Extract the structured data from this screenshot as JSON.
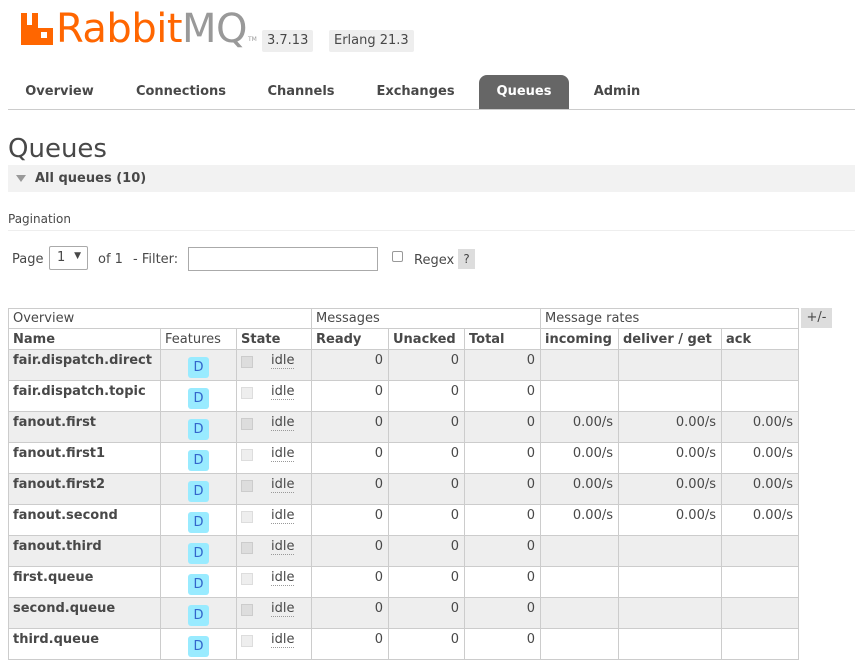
{
  "header": {
    "logo_text_rabbit": "Rabbit",
    "logo_text_mq": "MQ",
    "logo_tm": "TM",
    "version": "3.7.13",
    "erlang": "Erlang 21.3"
  },
  "nav": {
    "tabs": [
      {
        "label": "Overview"
      },
      {
        "label": "Connections"
      },
      {
        "label": "Channels"
      },
      {
        "label": "Exchanges"
      },
      {
        "label": "Queues",
        "active": true
      },
      {
        "label": "Admin"
      }
    ]
  },
  "page": {
    "title": "Queues",
    "section": "All queues (10)"
  },
  "pagination": {
    "title": "Pagination",
    "page_label": "Page",
    "page_value": "1",
    "of_label": "of 1",
    "filter_label": "- Filter:",
    "filter_value": "",
    "regex_label": "Regex",
    "help_label": "?"
  },
  "table": {
    "groups": {
      "overview": "Overview",
      "messages": "Messages",
      "rates": "Message rates"
    },
    "toggle_label": "+/-",
    "columns": {
      "name": "Name",
      "features": "Features",
      "state": "State",
      "ready": "Ready",
      "unacked": "Unacked",
      "total": "Total",
      "incoming": "incoming",
      "deliver_get": "deliver / get",
      "ack": "ack"
    },
    "rows": [
      {
        "name": "fair.dispatch.direct",
        "feature": "D",
        "state": "idle",
        "ready": "0",
        "unacked": "0",
        "total": "0",
        "incoming": "",
        "deliver_get": "",
        "ack": ""
      },
      {
        "name": "fair.dispatch.topic",
        "feature": "D",
        "state": "idle",
        "ready": "0",
        "unacked": "0",
        "total": "0",
        "incoming": "",
        "deliver_get": "",
        "ack": ""
      },
      {
        "name": "fanout.first",
        "feature": "D",
        "state": "idle",
        "ready": "0",
        "unacked": "0",
        "total": "0",
        "incoming": "0.00/s",
        "deliver_get": "0.00/s",
        "ack": "0.00/s"
      },
      {
        "name": "fanout.first1",
        "feature": "D",
        "state": "idle",
        "ready": "0",
        "unacked": "0",
        "total": "0",
        "incoming": "0.00/s",
        "deliver_get": "0.00/s",
        "ack": "0.00/s"
      },
      {
        "name": "fanout.first2",
        "feature": "D",
        "state": "idle",
        "ready": "0",
        "unacked": "0",
        "total": "0",
        "incoming": "0.00/s",
        "deliver_get": "0.00/s",
        "ack": "0.00/s"
      },
      {
        "name": "fanout.second",
        "feature": "D",
        "state": "idle",
        "ready": "0",
        "unacked": "0",
        "total": "0",
        "incoming": "0.00/s",
        "deliver_get": "0.00/s",
        "ack": "0.00/s"
      },
      {
        "name": "fanout.third",
        "feature": "D",
        "state": "idle",
        "ready": "0",
        "unacked": "0",
        "total": "0",
        "incoming": "",
        "deliver_get": "",
        "ack": ""
      },
      {
        "name": "first.queue",
        "feature": "D",
        "state": "idle",
        "ready": "0",
        "unacked": "0",
        "total": "0",
        "incoming": "",
        "deliver_get": "",
        "ack": ""
      },
      {
        "name": "second.queue",
        "feature": "D",
        "state": "idle",
        "ready": "0",
        "unacked": "0",
        "total": "0",
        "incoming": "",
        "deliver_get": "",
        "ack": ""
      },
      {
        "name": "third.queue",
        "feature": "D",
        "state": "idle",
        "ready": "0",
        "unacked": "0",
        "total": "0",
        "incoming": "",
        "deliver_get": "",
        "ack": ""
      }
    ]
  },
  "colors": {
    "brand_orange": "#ff6600",
    "active_tab": "#666666",
    "feature_badge": "#99ebff"
  }
}
